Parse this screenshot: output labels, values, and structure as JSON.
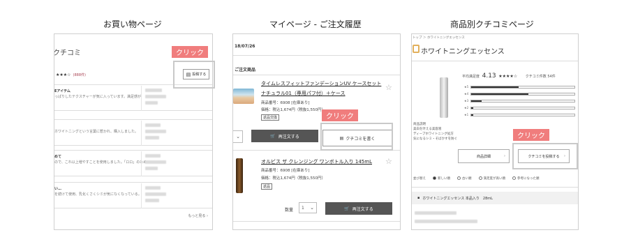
{
  "headings": {
    "p1": "お買い物ページ",
    "p2": "マイページ - ご注文履歴",
    "p3": "商品別クチコミページ"
  },
  "click_label": "クリック",
  "p1": {
    "title": "クチコミ",
    "stars": "★★★☆",
    "count": "(888件)",
    "post_button": "投稿する",
    "reviews": [
      {
        "title": "Eアイテム",
        "body": "っぱりしたテクスチャーが気に入っています。満足感が"
      },
      {
        "title": "",
        "body": "ホワイトニングという言葉に惹かれ、購入しました。"
      },
      {
        "title": "めて",
        "body": "ので、これ以上増やすことを使用しました。「ロロ」のため"
      },
      {
        "title": "い…",
        "body": "を続けて使用、乳化くさくシミが気になくなっている。"
      }
    ],
    "more": "もっと見る ›"
  },
  "p2": {
    "date": "18/07/26",
    "section": "ご注文商品",
    "item1": {
      "name_line1": "タイムレスフィットファンデーションUV ケースセット",
      "name_line2": "ナチュラル01（専用パフ付）＋ケース",
      "code": "商品番号：6908 [在庫あり]",
      "price": "価格：税込1,674円（税抜1,550円）",
      "badge": "返品交換"
    },
    "reorder_label": "再注文する",
    "review_label": "クチコミを書く",
    "item2": {
      "name": "オルビス ザ クレンジング ワンボトル入り 145mL",
      "code": "商品番号：6908 [在庫あり]",
      "price": "価格：税込1,674円（税抜1,550円）",
      "badge": "返品"
    },
    "qty_label": "数量",
    "qty_value": "1"
  },
  "p3": {
    "breadcrumb": "トップ ＞ ホワイトニングエッセンス",
    "title": "ホワイトニングエッセンス",
    "score_label": "平均満足度",
    "score": "4.13",
    "score_stars": "★★★★☆",
    "score_count": "クチコミ件数 54件",
    "bars": [
      {
        "label": "★5",
        "pct": 0.46
      },
      {
        "label": "★4",
        "pct": 0.55
      },
      {
        "label": "★3",
        "pct": 0.1
      },
      {
        "label": "★2",
        "pct": 0.02
      },
      {
        "label": "★1",
        "pct": 0.02
      }
    ],
    "desc_lines": [
      "商品説明",
      "美白を叶える美容液",
      "ディープホワイトニング処方",
      "気になるシミ・そばかすを防ぐ"
    ],
    "detail_button": "商品詳細",
    "post_button": "クチコミを投稿する",
    "filters": [
      "並び替え",
      "新しい順",
      "古い順",
      "満足度が高い順",
      "参考になった順"
    ],
    "sub_label": "ホワイトニングエッセンス 本品入り　28mL"
  }
}
